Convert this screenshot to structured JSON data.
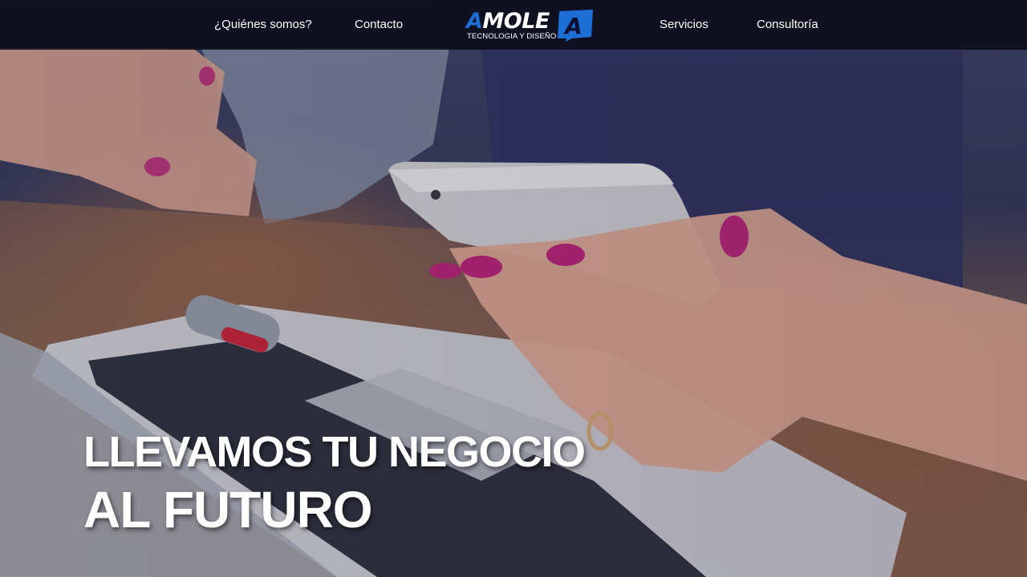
{
  "nav": {
    "items": [
      {
        "label": "¿Quiénes somos?"
      },
      {
        "label": "Contacto"
      },
      {
        "label": "Servicios"
      },
      {
        "label": "Consultoría"
      }
    ]
  },
  "logo": {
    "word_initial": "A",
    "word_rest": "MOLE",
    "badge_letter": "A",
    "tagline": "TECNOLOGIA Y DISEÑO",
    "brand_color": "#1d6fd6"
  },
  "hero": {
    "headline_line1": "LLEVAMOS TU NEGOCIO",
    "headline_line2": "AL FUTURO"
  },
  "colors": {
    "navbar_bg": "#0a0a16",
    "text": "#ffffff",
    "accent": "#1d6fd6"
  }
}
